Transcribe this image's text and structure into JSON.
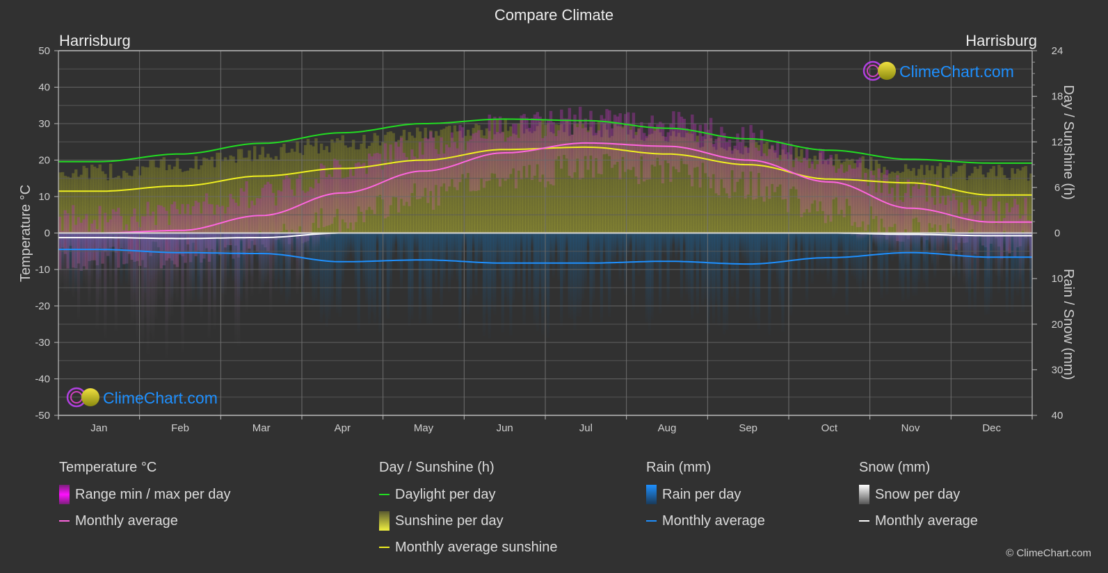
{
  "title": "Compare Climate",
  "city_left": "Harrisburg",
  "city_right": "Harrisburg",
  "watermark": "ClimeChart.com",
  "copyright": "© ClimeChart.com",
  "legend": {
    "temperature": {
      "header": "Temperature °C",
      "range_label": "Range min / max per day",
      "avg_label": "Monthly average"
    },
    "sunshine": {
      "header": "Day / Sunshine (h)",
      "daylight_label": "Daylight per day",
      "sunshine_label": "Sunshine per day",
      "avg_label": "Monthly average sunshine"
    },
    "rain": {
      "header": "Rain (mm)",
      "per_day_label": "Rain per day",
      "avg_label": "Monthly average"
    },
    "snow": {
      "header": "Snow (mm)",
      "per_day_label": "Snow per day",
      "avg_label": "Monthly average"
    }
  },
  "colors": {
    "temp_avg": "#ff66e0",
    "temp_range": "#e020e0",
    "daylight": "#22dd22",
    "sunshine_avg": "#f0f020",
    "sunshine_fill": "#9a9a30",
    "rain_avg": "#1e90ff",
    "rain_fill": "#1c5a8a",
    "snow_avg": "#ffffff",
    "background": "#313131",
    "grid": "#5a5a5a"
  },
  "chart_data": {
    "type": "line",
    "title": "Compare Climate",
    "categories": [
      "Jan",
      "Feb",
      "Mar",
      "Apr",
      "May",
      "Jun",
      "Jul",
      "Aug",
      "Sep",
      "Oct",
      "Nov",
      "Dec"
    ],
    "left_axis": {
      "label": "Temperature °C",
      "range": [
        -50,
        50
      ],
      "ticks": [
        50,
        40,
        30,
        20,
        10,
        0,
        -10,
        -20,
        -30,
        -40,
        -50
      ]
    },
    "right_axis_top": {
      "label": "Day / Sunshine (h)",
      "range": [
        0,
        24
      ],
      "ticks": [
        24,
        18,
        12,
        6,
        0
      ]
    },
    "right_axis_bottom": {
      "label": "Rain / Snow (mm)",
      "range": [
        0,
        40
      ],
      "ticks": [
        0,
        10,
        20,
        30,
        40
      ]
    },
    "grid": true,
    "legend_placement": "bottom",
    "series": [
      {
        "name": "Temperature monthly average",
        "axis": "left",
        "unit": "°C",
        "values": [
          0.0,
          0.7,
          4.8,
          11.0,
          17.0,
          22.0,
          24.7,
          23.8,
          20.0,
          14.0,
          6.8,
          3.0
        ]
      },
      {
        "name": "Daylight per day",
        "axis": "right_top",
        "unit": "h",
        "values": [
          9.4,
          10.4,
          11.8,
          13.2,
          14.4,
          15.0,
          14.8,
          13.8,
          12.4,
          10.9,
          9.7,
          9.2
        ]
      },
      {
        "name": "Monthly average sunshine",
        "axis": "right_top",
        "unit": "h",
        "values": [
          5.5,
          6.2,
          7.5,
          8.5,
          9.6,
          11.0,
          11.3,
          10.4,
          9.0,
          7.1,
          6.6,
          5.0
        ]
      },
      {
        "name": "Rain monthly average",
        "axis": "right_bottom",
        "unit": "mm",
        "values": [
          3.6,
          4.3,
          4.5,
          6.3,
          5.9,
          6.6,
          6.6,
          6.2,
          6.8,
          5.4,
          4.3,
          5.3
        ]
      },
      {
        "name": "Snow monthly average",
        "axis": "right_bottom",
        "unit": "mm",
        "values": [
          1.0,
          1.2,
          1.0,
          0.0,
          0.0,
          0.0,
          0.0,
          0.0,
          0.0,
          0.0,
          0.3,
          0.6
        ]
      },
      {
        "name": "Temperature daily max (approx band top)",
        "axis": "left",
        "unit": "°C",
        "values": [
          4,
          6,
          11,
          18,
          24,
          29,
          31,
          30,
          26,
          19,
          12,
          6
        ]
      },
      {
        "name": "Temperature daily min (approx band bottom)",
        "axis": "left",
        "unit": "°C",
        "values": [
          -7,
          -6,
          -2,
          4,
          10,
          15,
          18,
          17,
          13,
          6,
          1,
          -3
        ]
      },
      {
        "name": "Sunshine per day (approx band top)",
        "axis": "right_top",
        "unit": "h",
        "values": [
          8.0,
          9.0,
          10.5,
          11.8,
          13.2,
          14.0,
          13.8,
          12.8,
          11.3,
          9.8,
          8.4,
          7.9
        ]
      }
    ]
  }
}
